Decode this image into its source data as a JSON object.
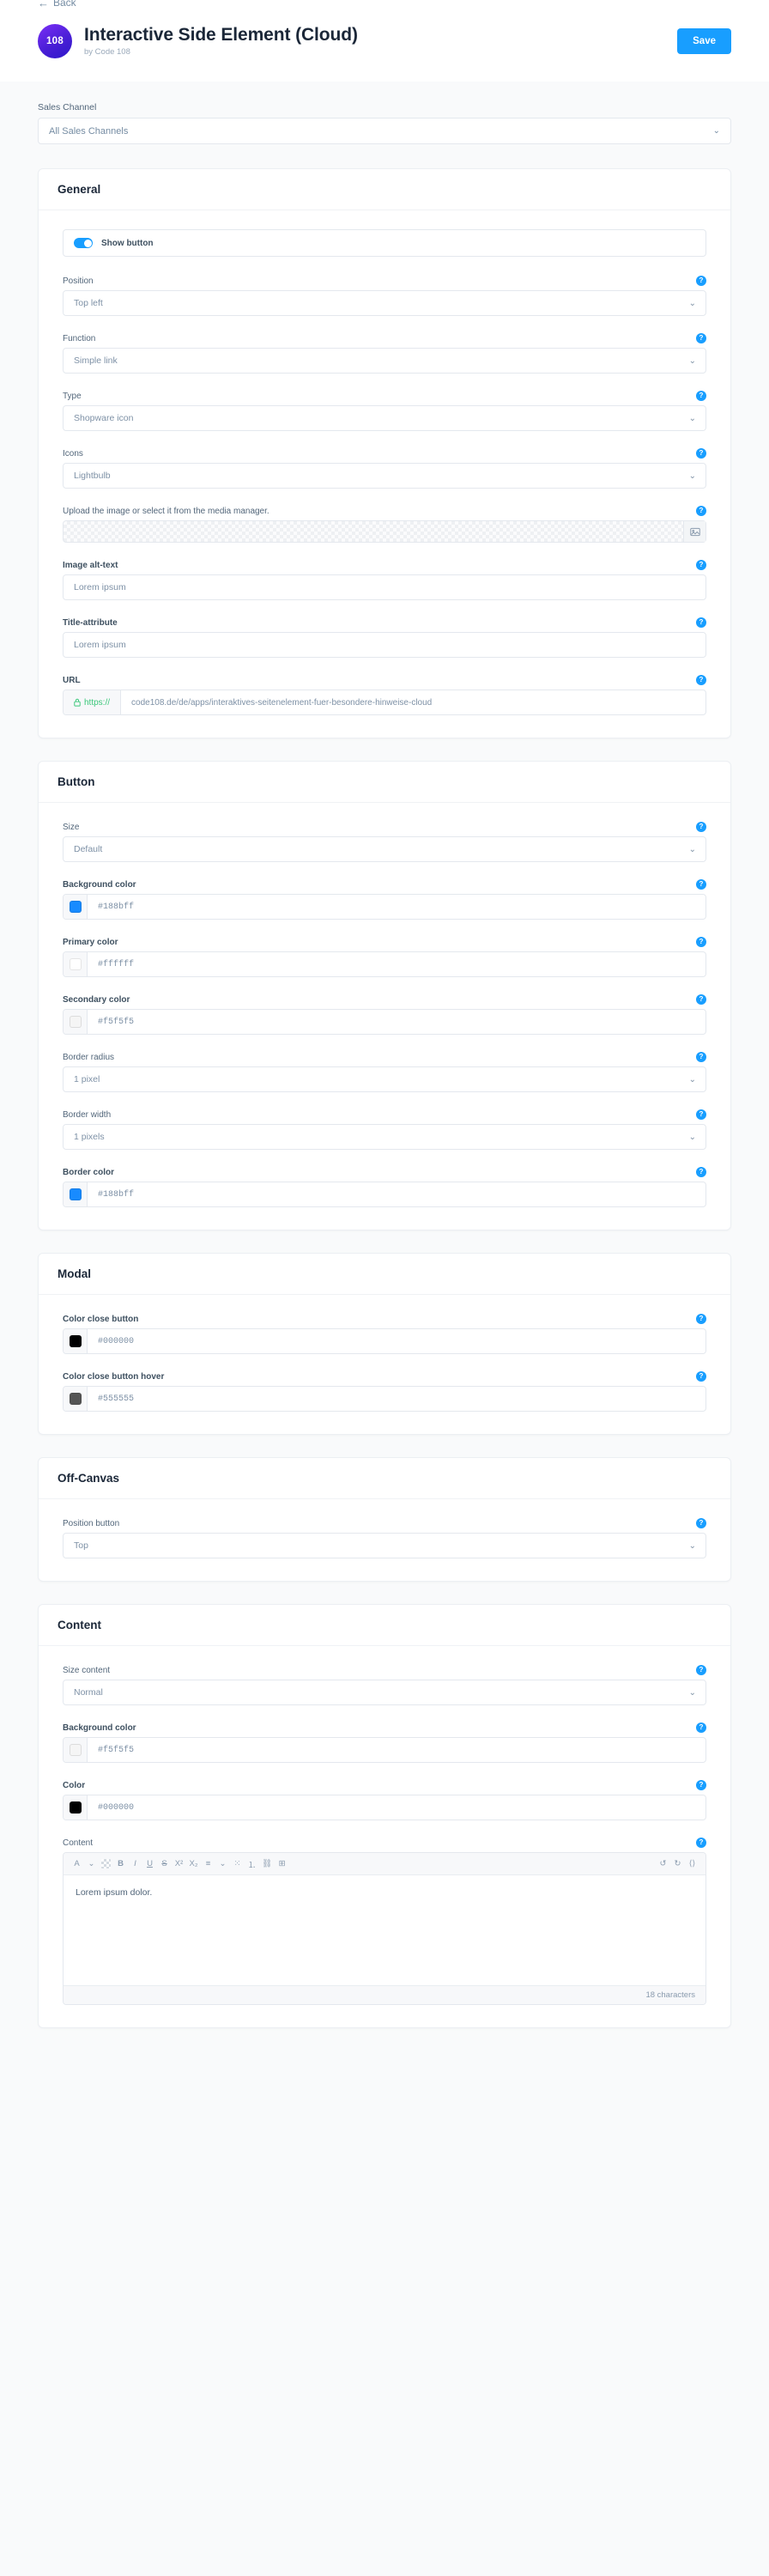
{
  "header": {
    "back_label": "Back",
    "logo_text": "108",
    "title": "Interactive Side Element (Cloud)",
    "subtitle": "by Code 108",
    "save_label": "Save",
    "accent_color": "#189eff"
  },
  "sales_channel": {
    "label": "Sales Channel",
    "value": "All Sales Channels"
  },
  "help_glyph": "?",
  "chevron_glyph": "⌄",
  "general": {
    "title": "General",
    "toggle": {
      "label": "Show button",
      "enabled": true
    },
    "position": {
      "label": "Position",
      "value": "Top left"
    },
    "function": {
      "label": "Function",
      "value": "Simple link"
    },
    "type": {
      "label": "Type",
      "value": "Shopware icon"
    },
    "icons": {
      "label": "Icons",
      "value": "Lightbulb"
    },
    "media": {
      "label": "Upload the image or select it from the media manager."
    },
    "image_alt": {
      "label": "Image alt-text",
      "value": "Lorem ipsum"
    },
    "title_attribute": {
      "label": "Title-attribute",
      "value": "Lorem ipsum"
    },
    "url": {
      "label": "URL",
      "prefix": "https://",
      "value": "code108.de/de/apps/interaktives-seitenelement-fuer-besondere-hinweise-cloud"
    }
  },
  "button": {
    "title": "Button",
    "size": {
      "label": "Size",
      "value": "Default"
    },
    "background_color": {
      "label": "Background color",
      "value": "#188bff",
      "swatch": "#188bff"
    },
    "primary_color": {
      "label": "Primary color",
      "value": "#ffffff",
      "swatch": "#ffffff"
    },
    "secondary_color": {
      "label": "Secondary color",
      "value": "#f5f5f5",
      "swatch": "#f5f5f5"
    },
    "border_radius": {
      "label": "Border radius",
      "value": "1 pixel"
    },
    "border_width": {
      "label": "Border width",
      "value": "1 pixels"
    },
    "border_color": {
      "label": "Border color",
      "value": "#188bff",
      "swatch": "#188bff"
    }
  },
  "modal": {
    "title": "Modal",
    "close_color": {
      "label": "Color close button",
      "value": "#000000",
      "swatch": "#000000"
    },
    "close_color_hover": {
      "label": "Color close button hover",
      "value": "#555555",
      "swatch": "#555555"
    }
  },
  "offcanvas": {
    "title": "Off-Canvas",
    "position_button": {
      "label": "Position button",
      "value": "Top"
    }
  },
  "content": {
    "title": "Content",
    "size_content": {
      "label": "Size content",
      "value": "Normal"
    },
    "background_color": {
      "label": "Background color",
      "value": "#f5f5f5",
      "swatch": "#f5f5f5"
    },
    "color": {
      "label": "Color",
      "value": "#000000",
      "swatch": "#000000"
    },
    "editor": {
      "label": "Content",
      "text": "Lorem ipsum dolor.",
      "char_count": "18 characters",
      "toolbar": [
        {
          "name": "font-format-icon",
          "glyph": "A"
        },
        {
          "name": "font-format-chevron-icon",
          "glyph": "⌄"
        },
        {
          "name": "text-color-icon",
          "glyph": ""
        },
        {
          "name": "bold-icon",
          "glyph": "B"
        },
        {
          "name": "italic-icon",
          "glyph": "I"
        },
        {
          "name": "underline-icon",
          "glyph": "U"
        },
        {
          "name": "strikethrough-icon",
          "glyph": "S"
        },
        {
          "name": "superscript-icon",
          "glyph": "X²"
        },
        {
          "name": "subscript-icon",
          "glyph": "X₂"
        },
        {
          "name": "align-icon",
          "glyph": "≡"
        },
        {
          "name": "align-chevron-icon",
          "glyph": "⌄"
        },
        {
          "name": "bullet-list-icon",
          "glyph": "⁙"
        },
        {
          "name": "numbered-list-icon",
          "glyph": "⒈"
        },
        {
          "name": "link-icon",
          "glyph": "⛓"
        },
        {
          "name": "table-icon",
          "glyph": "⊞"
        }
      ],
      "toolbar_right": [
        {
          "name": "undo-icon",
          "glyph": "↺"
        },
        {
          "name": "redo-icon",
          "glyph": "↻"
        },
        {
          "name": "code-view-icon",
          "glyph": "⟨⟩"
        }
      ]
    }
  }
}
